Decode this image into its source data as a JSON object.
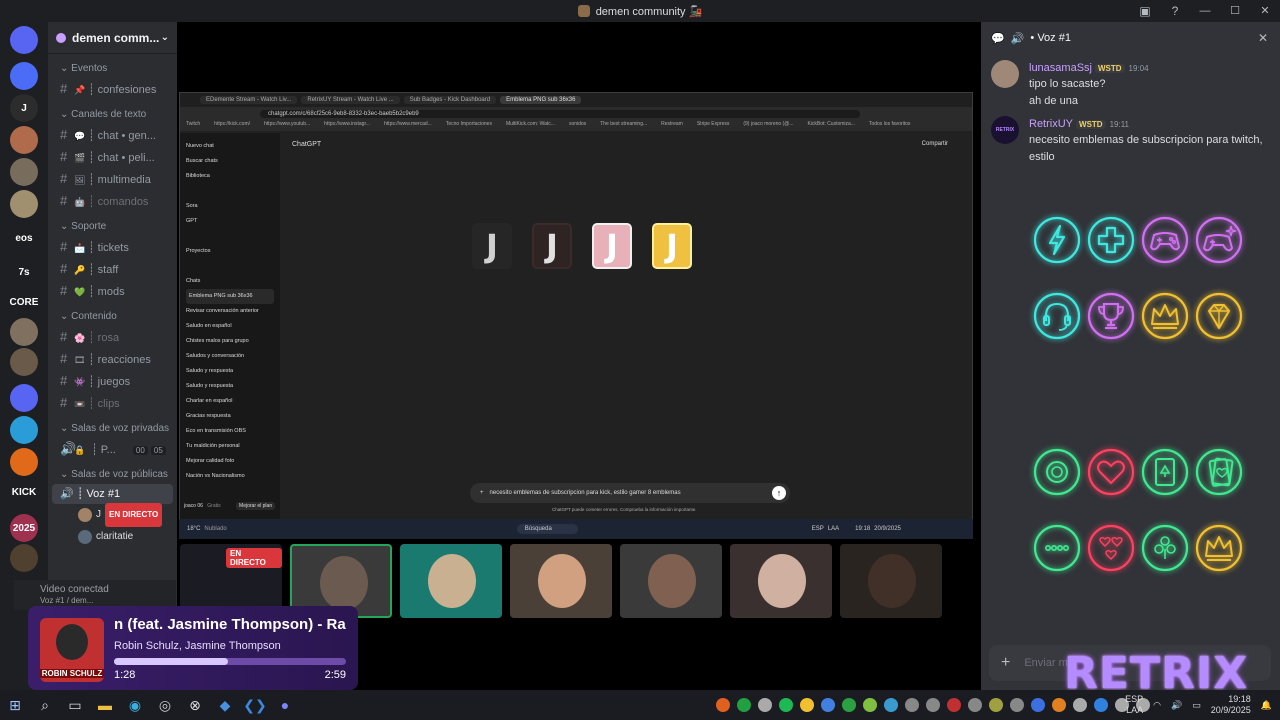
{
  "window": {
    "title": "demen community 🚂"
  },
  "server_rail": {
    "items": [
      {
        "label": "",
        "icon": "discord-logo-icon",
        "color": "#5865f2"
      },
      {
        "label": "",
        "icon": "server-icon",
        "color": "#4a6cf7"
      },
      {
        "label": "J",
        "icon": "server-j-icon",
        "color": "#2c2c2c"
      },
      {
        "label": "",
        "icon": "server-avatar-icon",
        "color": "#b06b4c"
      },
      {
        "label": "",
        "icon": "server-avatar-icon",
        "color": "#786c5c"
      },
      {
        "label": "",
        "icon": "server-avatar-icon",
        "color": "#a09070"
      },
      {
        "label": "eos",
        "icon": "server-eos-icon",
        "color": "#1e1f22"
      },
      {
        "label": "7s",
        "icon": "server-7s-icon",
        "color": "#1e1f22"
      },
      {
        "label": "CORE",
        "icon": "server-core-icon",
        "color": "#1e1f22"
      },
      {
        "label": "",
        "icon": "server-avatar-icon",
        "color": "#807060"
      },
      {
        "label": "",
        "icon": "server-avatar-icon",
        "color": "#6a5a4a"
      },
      {
        "label": "",
        "icon": "folder-icon",
        "color": "#5865f2"
      },
      {
        "label": "",
        "icon": "server-diamond-icon",
        "color": "#2a9dd8"
      },
      {
        "label": "",
        "icon": "server-diamond-icon",
        "color": "#e06a1a"
      },
      {
        "label": "KICK",
        "icon": "kick-icon",
        "color": "#1e1f22"
      },
      {
        "label": "2025",
        "icon": "server-avatar-icon",
        "color": "#a03050"
      },
      {
        "label": "",
        "icon": "server-avatar-icon",
        "color": "#504030"
      }
    ]
  },
  "sidebar": {
    "guild_name": "demen comm...",
    "sections": [
      {
        "category": "Eventos",
        "channels": [
          {
            "emoji": "📌",
            "name": "┊ confesiones",
            "dim": false
          }
        ]
      },
      {
        "category": "Canales de texto",
        "channels": [
          {
            "emoji": "💬",
            "name": "┊ chat • gen...",
            "dim": false
          },
          {
            "emoji": "🎬",
            "name": "┊ chat • peli...",
            "dim": false
          },
          {
            "emoji": "🖼",
            "name": "┊ multimedia",
            "dim": false
          },
          {
            "emoji": "🤖",
            "name": "┊ comandos",
            "dim": true
          }
        ]
      },
      {
        "category": "Soporte",
        "channels": [
          {
            "emoji": "📩",
            "name": "┊ tickets",
            "dim": false
          },
          {
            "emoji": "🔑",
            "name": "┊ staff",
            "dim": false
          },
          {
            "emoji": "💚",
            "name": "┊ mods",
            "dim": false
          }
        ]
      },
      {
        "category": "Contenido",
        "channels": [
          {
            "emoji": "🌸",
            "name": "┊ rosa",
            "dim": true
          },
          {
            "emoji": "🎞",
            "name": "┊ reacciones",
            "dim": false
          },
          {
            "emoji": "👾",
            "name": "┊ juegos",
            "dim": false
          },
          {
            "emoji": "📼",
            "name": "┊ clips",
            "dim": true
          }
        ]
      }
    ],
    "private_voice_category": "Salas de voz privadas",
    "private_voice_channel": "┊ P...",
    "private_voice_counts": [
      "00",
      "05"
    ],
    "public_voice_category": "Salas de voz públicas",
    "active_voice_channel": "┊ Voz #1",
    "voice_users": [
      {
        "name": "J",
        "live_badge": "EN DIRECTO"
      },
      {
        "name": "claritatie",
        "live_badge": ""
      }
    ],
    "video_connected": "Video conectad",
    "video_connected_sub": "Voz #1 / dem..."
  },
  "stream_browser": {
    "tabs": [
      "EDemente Stream - Watch Liv...",
      "RetrixUY Stream - Watch Live ...",
      "Sub Badges - Kick Dashboard",
      "Emblema PNG sub 36x36"
    ],
    "url": "chatgpt.com/c/68cf25c6-9eb8-8332-b3ec-baeb5b2c9eb9",
    "bookmarks": [
      "Twitch",
      "https://kick.com/",
      "https://www.youtub...",
      "https://www.instagr...",
      "https://www.mercad...",
      "Tecno Importaciones",
      "MultiKick.com: Watc...",
      "sonidos",
      "The best streaming...",
      "Restream",
      "Stripe Express",
      "(9) joaco moreno (@...",
      "KickBot: Customiza...",
      "Todos los favoritos"
    ],
    "gpt_sidebar": [
      "Nuevo chat",
      "Buscar chats",
      "Biblioteca",
      "",
      "Sora",
      "GPT",
      "",
      "Proyectos",
      "",
      "Chats",
      "Emblema PNG sub 36x36",
      "Revisar conversación anterior",
      "Saludo en español",
      "Chistes malos para grupo",
      "Saludos y conversación",
      "Saludo y respuesta",
      "Saludo y respuesta",
      "Charlar en español",
      "Gracias respuesta",
      "Eco en transmisión OBS",
      "Tu maldición personal",
      "Mejorar calidad foto",
      "Nación vs Nacionalismo"
    ],
    "gpt_user": "joaco 06",
    "gpt_user_plan": "Gratis",
    "gpt_upgrade": "Mejorar el plan",
    "gpt_title": "ChatGPT",
    "gpt_share": "Compartir",
    "prompt_text": "necesito emblemas de subscripcion para kick, estilo gamer 8 emblemas",
    "disclaimer": "ChatGPT puede cometer errores. Comprueba la información importante.",
    "tiles": [
      {
        "letter": "J",
        "bg": "#262626",
        "fg": "#d0d0d0",
        "border": "#262626"
      },
      {
        "letter": "J",
        "bg": "#2e2424",
        "fg": "#e0e0e0",
        "border": "#3a2a2a"
      },
      {
        "letter": "J",
        "bg": "#e8b0b8",
        "fg": "#ffffff",
        "border": "#f0f0f0"
      },
      {
        "letter": "J",
        "bg": "#f0c040",
        "fg": "#ffffff",
        "border": "#fff0a0"
      }
    ]
  },
  "inner_taskbar": {
    "weather": "18°C",
    "weather_sub": "Nublado",
    "search": "Búsqueda",
    "lang": "ESP",
    "lang_sub": "LAA",
    "time": "19:18",
    "date": "20/9/2025"
  },
  "video_tiles": [
    {
      "color": "#1b1b24",
      "live": "EN DIRECTO",
      "head": ""
    },
    {
      "color": "#3a3a3a",
      "live": "",
      "head": "#6a5a50"
    },
    {
      "color": "#1a7a70",
      "live": "",
      "head": "#c8b090"
    },
    {
      "color": "#4a4038",
      "live": "",
      "head": "#d0a080"
    },
    {
      "color": "#3a3a3a",
      "live": "",
      "head": "#806050"
    },
    {
      "color": "#3a3030",
      "live": "",
      "head": "#d0b0a0"
    },
    {
      "color": "#2a2420",
      "live": "",
      "head": "#403028"
    }
  ],
  "music": {
    "song": "n (feat. Jasmine Thompson) - Ra",
    "artist": "Robin Schulz, Jasmine Thompson",
    "elapsed": "1:28",
    "duration": "2:59",
    "progress": 0.49,
    "cover_label": "ROBIN SCHULZ"
  },
  "chat": {
    "header_title": "• Voz #1",
    "messages": [
      {
        "user": "lunasamaSsj",
        "badge": "WSTD",
        "time": "19:04",
        "lines": [
          "tipo lo sacaste?",
          "ah de una"
        ],
        "avatar_color": "#a08878",
        "avatar_label": ""
      },
      {
        "user": "RetrixUY",
        "badge": "WSTD",
        "time": "19:11",
        "lines": [
          "necesito emblemas de subscripcion para twitch,",
          "estilo"
        ],
        "avatar_color": "#1a1030",
        "avatar_label": "RETRIX"
      }
    ],
    "input_placeholder": "Enviar m",
    "overlay_text": "RETRIX"
  },
  "neon_icons": [
    {
      "name": "lightning-icon",
      "color": "#3ee8e0"
    },
    {
      "name": "plus-icon",
      "color": "#3ee8e0"
    },
    {
      "name": "gamepad-icon",
      "color": "#d070f0"
    },
    {
      "name": "gamepad-sparkle-icon",
      "color": "#d070f0"
    },
    {
      "name": "headset-icon",
      "color": "#3ee8e0"
    },
    {
      "name": "trophy-icon",
      "color": "#d070f0"
    },
    {
      "name": "crown-icon",
      "color": "#f0c030"
    },
    {
      "name": "diamond-icon",
      "color": "#f0c030"
    },
    {
      "name": "poker-chip-icon",
      "color": "#40e890"
    },
    {
      "name": "heart-icon",
      "color": "#ff4060"
    },
    {
      "name": "ace-card-icon",
      "color": "#40e890"
    },
    {
      "name": "ace-hearts-cards-icon",
      "color": "#40e890"
    },
    {
      "name": "dots-icon",
      "color": "#40e890"
    },
    {
      "name": "hearts-icon",
      "color": "#ff4060"
    },
    {
      "name": "clubs-icon",
      "color": "#40e890"
    },
    {
      "name": "crown-icon",
      "color": "#f0c030"
    }
  ],
  "taskbar": {
    "lang": "ESP",
    "lang_sub": "LAA",
    "time": "19:18",
    "date": "20/9/2025"
  }
}
